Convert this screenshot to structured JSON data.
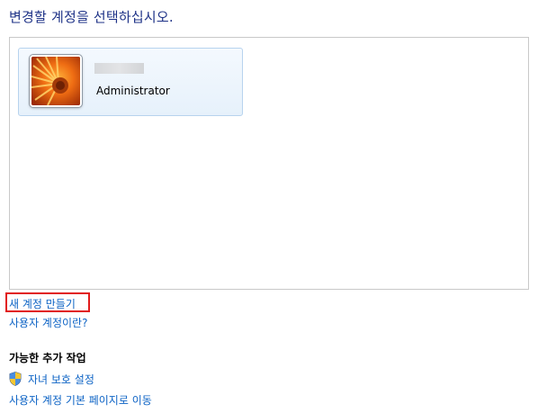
{
  "page": {
    "title": "변경할 계정을 선택하십시오."
  },
  "accounts": [
    {
      "name": "Administrator",
      "avatar_icon": "orange-flower-avatar"
    }
  ],
  "links": {
    "create_account": "새 계정 만들기",
    "what_is_account": "사용자 계정이란?"
  },
  "additional_tasks": {
    "heading": "가능한 추가 작업",
    "parental_controls": {
      "label": "자녀 보호 설정",
      "icon": "uac-shield-icon"
    },
    "go_to_main_page": "사용자 계정 기본 페이지로 이동"
  },
  "colors": {
    "title": "#1e3287",
    "link": "#0d63c5",
    "highlight": "#e11b1b",
    "tile_border": "#b7d3ee"
  }
}
